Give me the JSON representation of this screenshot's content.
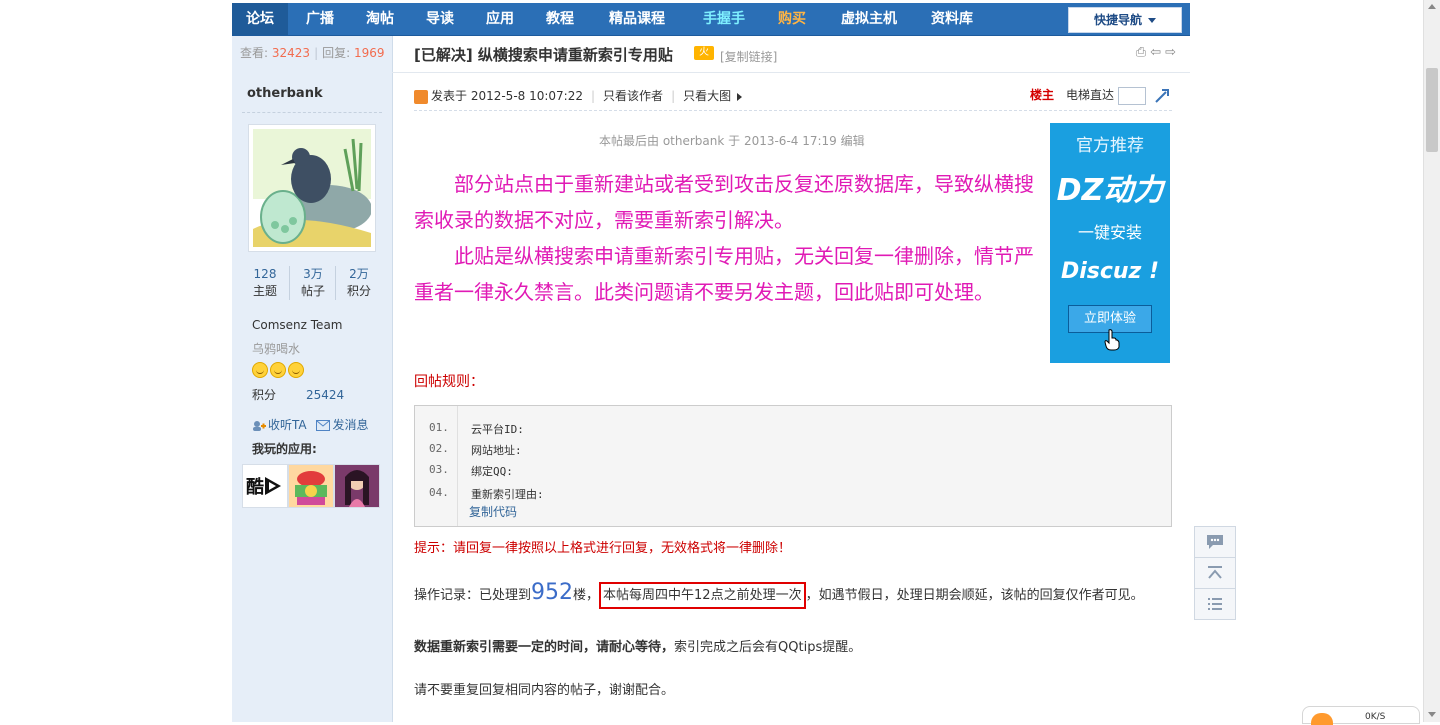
{
  "nav": {
    "items": [
      "论坛",
      "广播",
      "淘帖",
      "导读",
      "应用",
      "教程",
      "精品课程",
      "手握手",
      "购买",
      "虚拟主机",
      "资料库"
    ],
    "quick_nav": "快捷导航"
  },
  "sidebar": {
    "view_label": "查看:",
    "view_count": "32423",
    "reply_label": "回复:",
    "reply_count": "1969",
    "username": "otherbank",
    "stats": [
      {
        "num": "128",
        "label": "主题"
      },
      {
        "num": "3万",
        "label": "帖子"
      },
      {
        "num": "2万",
        "label": "积分"
      }
    ],
    "group": "Comsenz Team",
    "user_title": "乌鸦喝水",
    "points_label": "积分",
    "points_value": "25424",
    "follow": "收听TA",
    "message": "发消息",
    "apps_title": "我玩的应用:",
    "app_label": "酷"
  },
  "thread": {
    "title": "[已解决] 纵横搜索申请重新索引专用贴",
    "copy_link": "[复制链接]",
    "posted": "发表于 2012-5-8 10:07:22",
    "only_author": "只看该作者",
    "only_images": "只看大图",
    "floor_label": "楼主",
    "jump_label": "电梯直达",
    "edited": "本帖最后由 otherbank 于 2013-6-4 17:19 编辑",
    "body": [
      "部分站点由于重新建站或者受到攻击反复还原数据库，导致纵横搜索收录的数据不对应，需要重新索引解决。",
      "此贴是纵横搜索申请重新索引专用贴，无关回复一律删除，情节严重者一律永久禁言。此类问题请不要另发主题，回此贴即可处理。"
    ],
    "rules_title": "回帖规则：",
    "code_lines": [
      {
        "no": "01.",
        "text": "云平台ID:"
      },
      {
        "no": "02.",
        "text": "网站地址:"
      },
      {
        "no": "03.",
        "text": "绑定QQ:"
      },
      {
        "no": "04.",
        "text": "重新索引理由:"
      }
    ],
    "copy_code": "复制代码",
    "tip": "提示：请回复一律按照以上格式进行回复，无效格式将一律删除！",
    "oplog_prefix": "操作记录：已处理到",
    "oplog_number": "952",
    "oplog_floor": "楼，",
    "oplog_boxed": "本帖每周四中午12点之前处理一次",
    "oplog_suffix": "，如遇节假日，处理日期会顺延，该帖的回复仅作者可见。",
    "bold_text": "数据重新索引需要一定的时间，请耐心等待，",
    "after_bold": "索引完成之后会有QQtips提醒。",
    "please": "请不要重复回复相同内容的帖子，谢谢配合。"
  },
  "ad": {
    "line1": "官方推荐",
    "line2": "DZ动力",
    "line3": "一键安装",
    "line4": "Discuz !",
    "button": "立即体验"
  },
  "speed": {
    "up": "0K/S"
  }
}
